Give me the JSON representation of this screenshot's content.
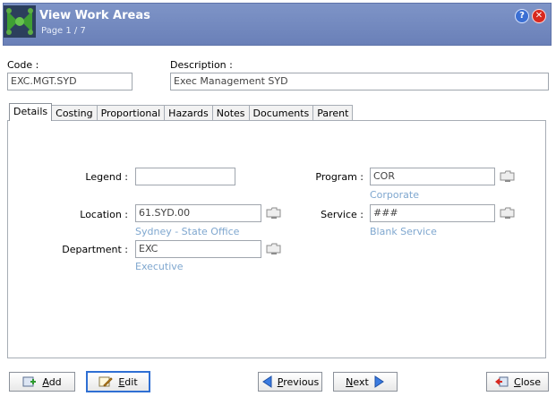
{
  "header": {
    "title": "View Work Areas",
    "subtitle": "Page 1 / 7",
    "help_label": "?",
    "close_label": "✕"
  },
  "code": {
    "label": "Code :",
    "value": "EXC.MGT.SYD"
  },
  "description": {
    "label": "Description :",
    "value": "Exec Management SYD"
  },
  "tabs": [
    "Details",
    "Costing",
    "Proportional",
    "Hazards",
    "Notes",
    "Documents",
    "Parent"
  ],
  "details": {
    "legend": {
      "label": "Legend :",
      "value": ""
    },
    "location": {
      "label": "Location :",
      "value": "61.SYD.00",
      "sub": "Sydney - State Office"
    },
    "department": {
      "label": "Department :",
      "value": "EXC",
      "sub": "Executive"
    },
    "program": {
      "label": "Program :",
      "value": "COR",
      "sub": "Corporate"
    },
    "service": {
      "label": "Service :",
      "value": "###",
      "sub": "Blank Service"
    }
  },
  "buttons": {
    "add": {
      "u": "A",
      "rest": "dd"
    },
    "edit": {
      "u": "E",
      "rest": "dit"
    },
    "previous": {
      "u": "P",
      "rest": "revious"
    },
    "next": {
      "u": "N",
      "rest": "ext"
    },
    "close": {
      "u": "C",
      "rest": "lose"
    }
  },
  "colors": {
    "header": "#6f85bf",
    "link": "#7fa7cf",
    "focus": "#2f6fd3"
  }
}
